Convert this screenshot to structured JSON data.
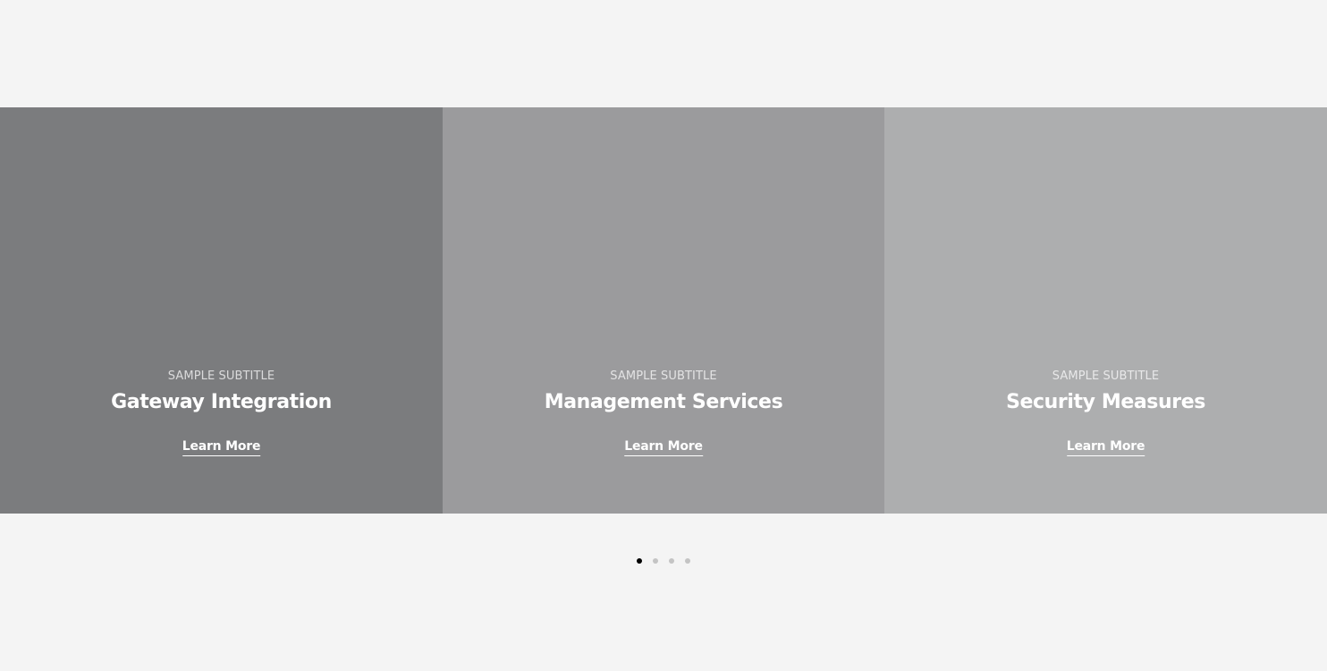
{
  "slides": [
    {
      "subtitle": "SAMPLE SUBTITLE",
      "title": "Gateway Integration",
      "link_label": "Learn More",
      "background": "#7b7c7e"
    },
    {
      "subtitle": "SAMPLE SUBTITLE",
      "title": "Management Services",
      "link_label": "Learn More",
      "background": "#9b9b9d"
    },
    {
      "subtitle": "SAMPLE SUBTITLE",
      "title": "Security Measures",
      "link_label": "Learn More",
      "background": "#adaeaf"
    }
  ],
  "pagination": {
    "count": 4,
    "active_index": 0,
    "active_color": "#000000",
    "inactive_color": "#c4c4c4"
  },
  "page_background": "#f4f4f4"
}
